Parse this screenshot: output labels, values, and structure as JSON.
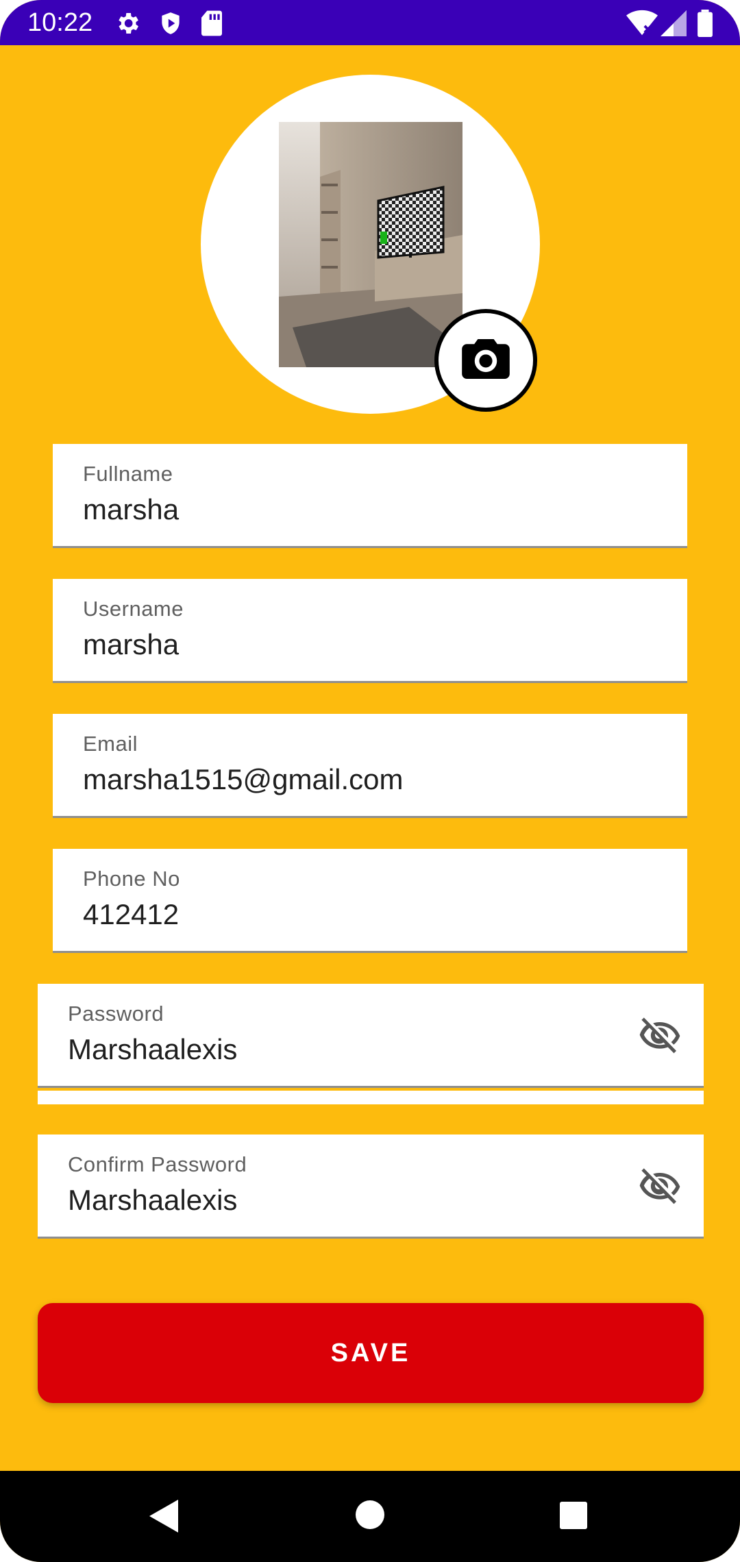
{
  "status_bar": {
    "time": "10:22",
    "left_icons": [
      "gear-icon",
      "shield-play-icon",
      "sd-card-icon"
    ],
    "right_icons": [
      "wifi-off-icon",
      "signal-icon",
      "battery-icon"
    ],
    "background": "#3A00B7"
  },
  "profile": {
    "photo_icon": "room-photo",
    "camera_icon": "camera-icon"
  },
  "form": {
    "fullname": {
      "label": "Fullname",
      "value": "marsha"
    },
    "username": {
      "label": "Username",
      "value": "marsha"
    },
    "email": {
      "label": "Email",
      "value": "marsha1515@gmail.com"
    },
    "phone": {
      "label": "Phone No",
      "value": "412412"
    },
    "password": {
      "label": "Password",
      "value": "Marshaalexis",
      "toggle_icon": "eye-off-icon"
    },
    "confirm_password": {
      "label": "Confirm Password",
      "value": "Marshaalexis",
      "toggle_icon": "eye-off-icon"
    }
  },
  "actions": {
    "save_label": "SAVE"
  },
  "nav": {
    "back_icon": "back-triangle-icon",
    "home_icon": "home-circle-icon",
    "recents_icon": "recents-square-icon"
  },
  "colors": {
    "background": "#FDBB0D",
    "save_button": "#DA0007",
    "status_bar": "#3A00B7"
  }
}
